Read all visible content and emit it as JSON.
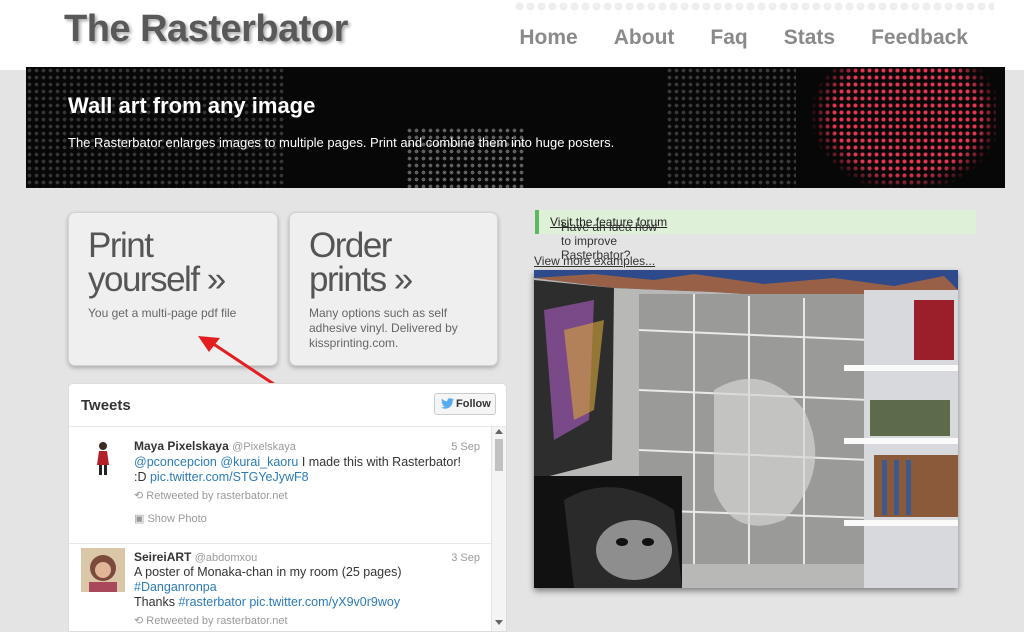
{
  "site": {
    "logo": "The Rasterbator"
  },
  "nav": [
    "Home",
    "About",
    "Faq",
    "Stats",
    "Feedback"
  ],
  "banner": {
    "title": "Wall art from any image",
    "subtitle": "The Rasterbator enlarges images to multiple pages. Print and combine them into huge posters."
  },
  "cards": [
    {
      "title_line1": "Print",
      "title_line2": "yourself »",
      "desc": [
        "You get a multi-page pdf file"
      ]
    },
    {
      "title_line1": "Order",
      "title_line2": "prints »",
      "desc": [
        "Many options such as self",
        "adhesive vinyl. Delivered by",
        "kissprinting.com."
      ]
    }
  ],
  "tweets_widget": {
    "title": "Tweets",
    "follow_label": "Follow",
    "tweets": [
      {
        "name": "Maya Pixelskaya",
        "handle": "@Pixelskaya",
        "date": "5 Sep",
        "mention1": "@pconcepcion",
        "mention2": "@kurai_kaoru",
        "text": " I made this with Rasterbator!",
        "text2": ":D ",
        "link": "pic.twitter.com/STGYeJywF8",
        "retweet": "Retweeted by rasterbator.net",
        "show_photo": "Show Photo"
      },
      {
        "name": "SeireiART",
        "handle": "@abdomxou",
        "date": "3 Sep",
        "text": "A poster of Monaka-chan in my room (25 pages)",
        "hashtag": "#Danganronpa",
        "text2": "Thanks ",
        "hashtag2": "#rasterbator",
        "link": "pic.twitter.com/yX9v0r9woy",
        "retweet": "Retweeted by rasterbator.net"
      }
    ]
  },
  "notice": {
    "text": "Have an idea how to improve Rasterbator? ",
    "link": "Visit the feature forum",
    "end": "!"
  },
  "examples_link": "View more examples...",
  "colors": {
    "accent_green": "#5cb85c",
    "link_blue": "#2b7bb9",
    "banner_red": "#ff3b5a"
  }
}
